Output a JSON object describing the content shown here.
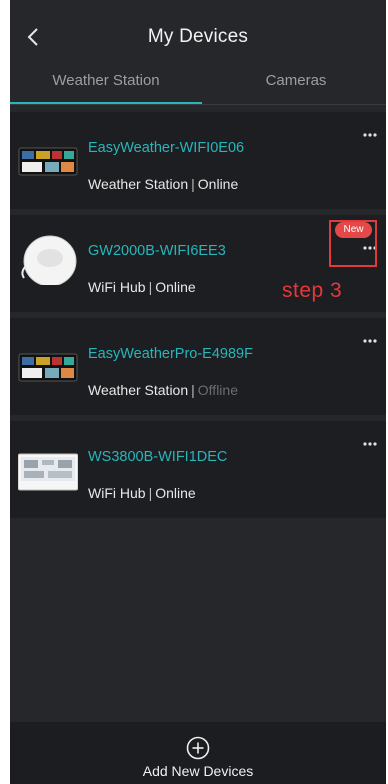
{
  "header": {
    "back_icon": "chevron-left-icon",
    "title": "My Devices"
  },
  "tabs": [
    {
      "label": "Weather Station",
      "active": true
    },
    {
      "label": "Cameras",
      "active": false
    }
  ],
  "devices": [
    {
      "name": "EasyWeather-WIFI0E06",
      "type": "Weather Station",
      "status": "Online",
      "online": true,
      "thumb": "weather-display-icon",
      "new": false
    },
    {
      "name": "GW2000B-WIFI6EE3",
      "type": "WiFi Hub",
      "status": "Online",
      "online": true,
      "thumb": "wifi-hub-icon",
      "new": true
    },
    {
      "name": "EasyWeatherPro-E4989F",
      "type": "Weather Station",
      "status": "Offline",
      "online": false,
      "thumb": "weather-display-icon",
      "new": false
    },
    {
      "name": "WS3800B-WIFI1DEC",
      "type": "WiFi Hub",
      "status": "Online",
      "online": true,
      "thumb": "lcd-console-icon",
      "new": false
    }
  ],
  "badge_new": "New",
  "annotation": "step 3",
  "separator": "|",
  "footer": {
    "add_icon": "plus-circle-icon",
    "add_label": "Add New Devices"
  },
  "colors": {
    "accent": "#2bb5b9",
    "background": "#26272b",
    "card": "#1d1e21",
    "annotation": "#e23a3a",
    "offline": "#6b6c70"
  }
}
